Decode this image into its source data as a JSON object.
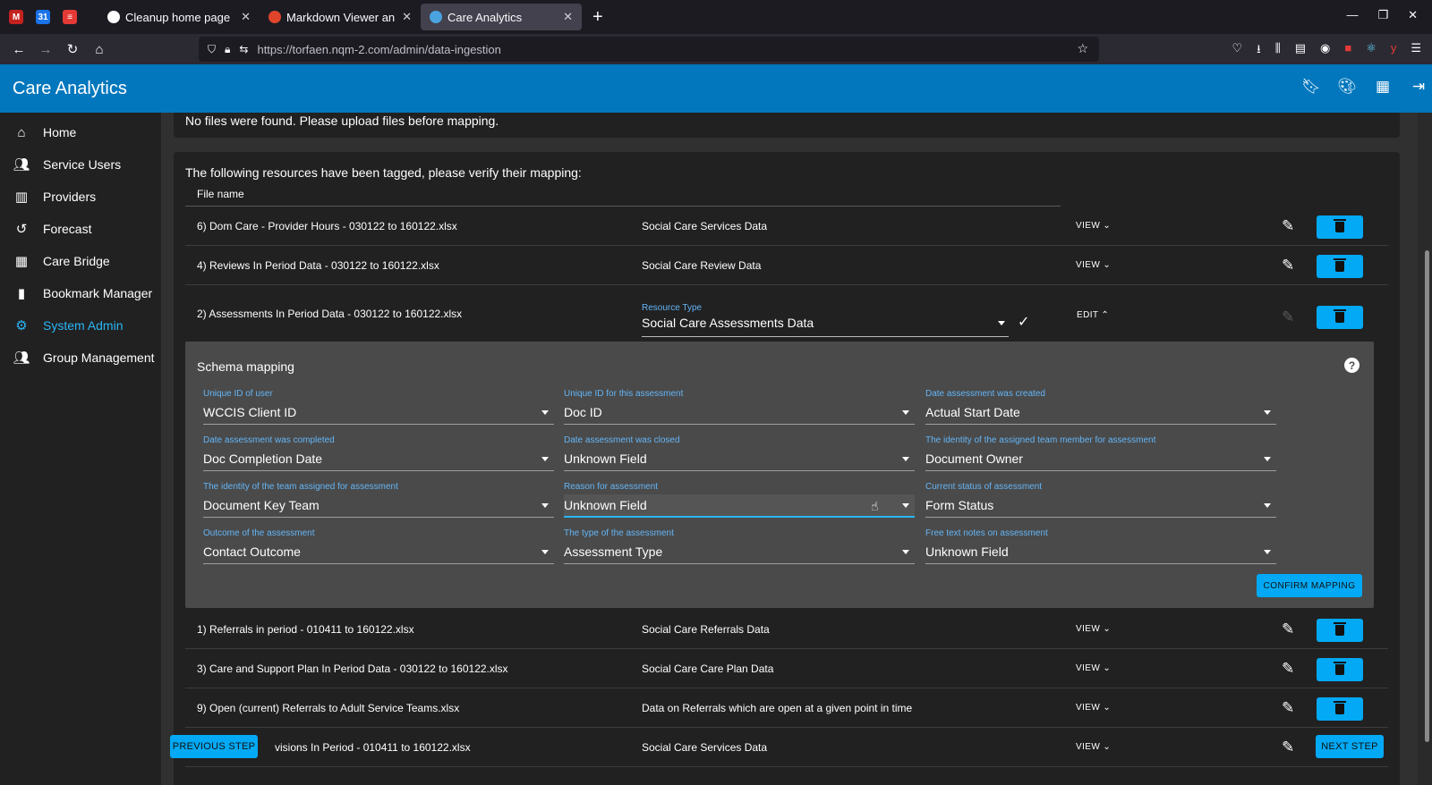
{
  "browser": {
    "tabs": [
      {
        "title": "Cleanup home page by a",
        "icon_color": "#ffffff"
      },
      {
        "title": "Markdown Viewer and Ed",
        "icon_color": "#e0452c"
      },
      {
        "title": "Care Analytics",
        "icon_color": "#4aa3df",
        "active": true
      }
    ],
    "new_tab": "+",
    "url": "https://torfaen.nqm-2.com/admin/data-ingestion",
    "colors": {
      "chrome_bg": "#1c1b22",
      "toolbar_bg": "#2b2a33"
    }
  },
  "app": {
    "title": "Care Analytics",
    "header_color": "#0277bd",
    "accent": "#03a9f4"
  },
  "sidebar": {
    "items": [
      {
        "label": "Home",
        "icon": "home-icon"
      },
      {
        "label": "Service Users",
        "icon": "people-icon"
      },
      {
        "label": "Providers",
        "icon": "building-icon"
      },
      {
        "label": "Forecast",
        "icon": "history-icon"
      },
      {
        "label": "Care Bridge",
        "icon": "grid-icon"
      },
      {
        "label": "Bookmark Manager",
        "icon": "bookmark-icon"
      },
      {
        "label": "System Admin",
        "icon": "gear-icon",
        "active": true
      },
      {
        "label": "Group Management",
        "icon": "group-add-icon"
      }
    ]
  },
  "main": {
    "no_files_msg": "No files were found. Please upload files before mapping.",
    "intro": "The following resources have been tagged, please verify their mapping:",
    "file_name_header": "File name",
    "view_label": "VIEW",
    "edit_label": "EDIT",
    "rows_top": [
      {
        "file": "6) Dom Care - Provider Hours - 030122 to 160122.xlsx",
        "type": "Social Care Services Data"
      },
      {
        "file": "4) Reviews In Period Data - 030122 to 160122.xlsx",
        "type": "Social Care Review Data"
      }
    ],
    "editing_row": {
      "file": "2) Assessments In Period Data - 030122 to 160122.xlsx",
      "resource_type_label": "Resource Type",
      "resource_type_value": "Social Care Assessments Data"
    },
    "schema": {
      "title": "Schema mapping",
      "help": "?",
      "fields": [
        {
          "label": "Unique ID of user",
          "value": "WCCIS Client ID"
        },
        {
          "label": "Unique ID for this assessment",
          "value": "Doc ID"
        },
        {
          "label": "Date assessment was created",
          "value": "Actual Start Date"
        },
        {
          "label": "Date assessment was completed",
          "value": "Doc Completion Date"
        },
        {
          "label": "Date assessment was closed",
          "value": "Unknown Field"
        },
        {
          "label": "The identity of the assigned team member for assessment",
          "value": "Document Owner"
        },
        {
          "label": "The identity of the team assigned for assessment",
          "value": "Document Key Team"
        },
        {
          "label": "Reason for assessment",
          "value": "Unknown Field"
        },
        {
          "label": "Current status of assessment",
          "value": "Form Status"
        },
        {
          "label": "Outcome of the assessment",
          "value": "Contact Outcome"
        },
        {
          "label": "The type of the assessment",
          "value": "Assessment Type"
        },
        {
          "label": "Free text notes on assessment",
          "value": "Unknown Field"
        }
      ],
      "confirm_label": "CONFIRM MAPPING"
    },
    "rows_bottom": [
      {
        "file": "1) Referrals in period - 010411 to 160122.xlsx",
        "type": "Social Care Referrals Data"
      },
      {
        "file": "3) Care and Support Plan In Period Data - 030122 to 160122.xlsx",
        "type": "Social Care Care Plan Data"
      },
      {
        "file": "9) Open (current) Referrals to Adult Service Teams.xlsx",
        "type": "Data on Referrals which are open at a given point in time"
      },
      {
        "file": "visions In Period - 010411 to 160122.xlsx",
        "type": "Social Care Services Data"
      }
    ],
    "prev_step": "PREVIOUS STEP",
    "next_step": "NEXT STEP"
  }
}
